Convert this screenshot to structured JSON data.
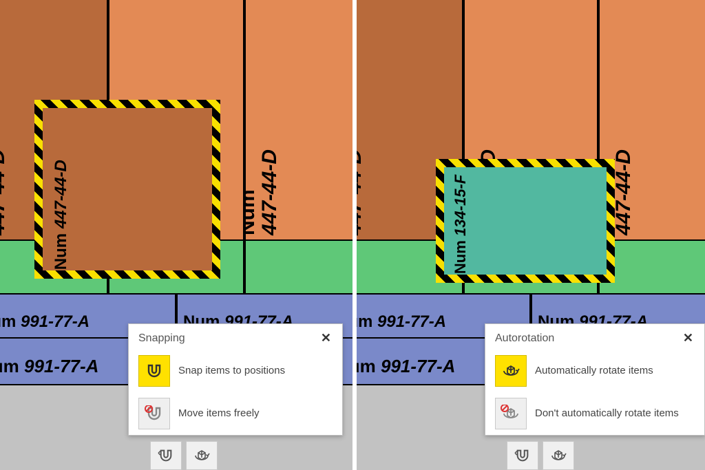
{
  "left": {
    "popup": {
      "title": "Snapping",
      "options": [
        {
          "label": "Snap items to positions",
          "active": true,
          "icon": "snap-on"
        },
        {
          "label": "Move items freely",
          "active": false,
          "icon": "snap-off"
        }
      ]
    },
    "boxes": {
      "orange_code": "447-44-D",
      "blue_code": "991-77-A",
      "prefix": "Num"
    }
  },
  "right": {
    "popup": {
      "title": "Autorotation",
      "options": [
        {
          "label": "Automatically rotate items",
          "active": true,
          "icon": "autorotate-on"
        },
        {
          "label": "Don't automatically rotate items",
          "active": false,
          "icon": "autorotate-off"
        }
      ]
    },
    "boxes": {
      "orange_code": "447-44-D",
      "blue_code": "991-77-A",
      "teal_code": "134-15-F",
      "prefix": "Num"
    }
  }
}
